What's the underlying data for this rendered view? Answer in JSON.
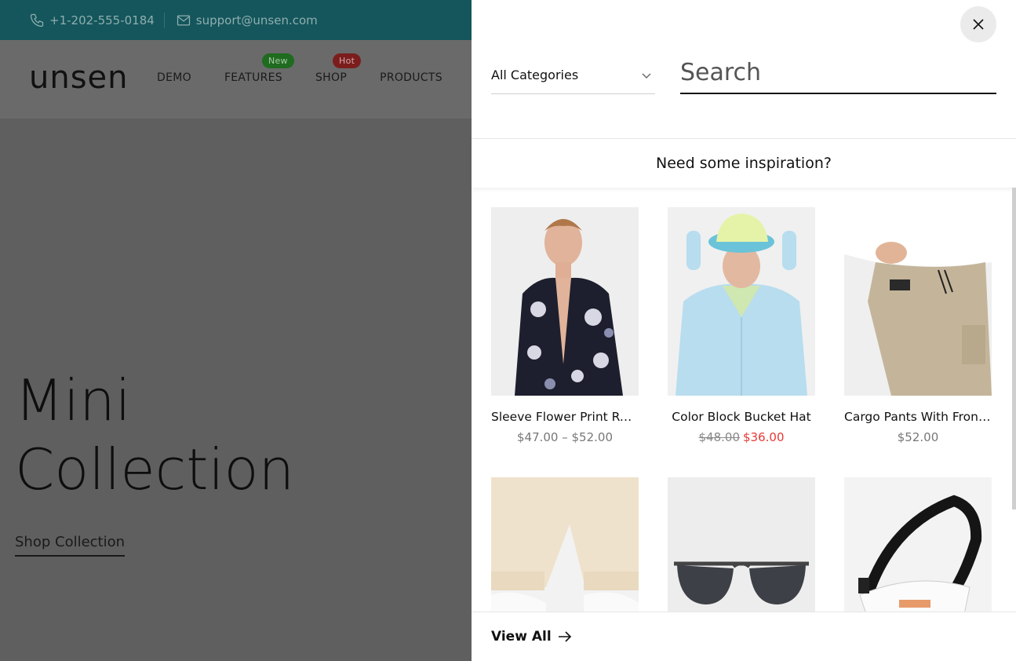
{
  "topbar": {
    "phone": "+1-202-555-0184",
    "email": "support@unsen.com",
    "icons": [
      "phone-icon",
      "mail-icon"
    ]
  },
  "header": {
    "logo": "unsen",
    "nav": [
      {
        "label": "DEMO",
        "badge": ""
      },
      {
        "label": "FEATURES",
        "badge": "New"
      },
      {
        "label": "SHOP",
        "badge": "Hot"
      },
      {
        "label": "PRODUCTS",
        "badge": ""
      }
    ]
  },
  "hero": {
    "title_line1": "Mini",
    "title_line2": "Collection",
    "link": "Shop Collection"
  },
  "search": {
    "category_selected": "All Categories",
    "placeholder": "Search",
    "inspiration_heading": "Need some inspiration?",
    "view_all": "View All"
  },
  "products": [
    {
      "name": "Sleeve Flower Print Resort Shirt",
      "price": "$47.00 – $52.00",
      "old_price": "",
      "sale_price": "",
      "image": "floral-shirt"
    },
    {
      "name": "Color Block Bucket Hat",
      "price": "",
      "old_price": "$48.00",
      "sale_price": "$36.00",
      "image": "bucket-hat"
    },
    {
      "name": "Cargo Pants With Front Pocket",
      "price": "$52.00",
      "old_price": "",
      "sale_price": "",
      "image": "cargo-pants"
    },
    {
      "name": "",
      "price": "",
      "old_price": "",
      "sale_price": "",
      "image": "joggers"
    },
    {
      "name": "",
      "price": "",
      "old_price": "",
      "sale_price": "",
      "image": "sunglasses"
    },
    {
      "name": "",
      "price": "",
      "old_price": "",
      "sale_price": "",
      "image": "belt-bag"
    }
  ],
  "colors": {
    "topbar": "#14565b",
    "sale": "#e53935",
    "badge_new": "#1f6b1f",
    "badge_hot": "#7b1d1d"
  }
}
